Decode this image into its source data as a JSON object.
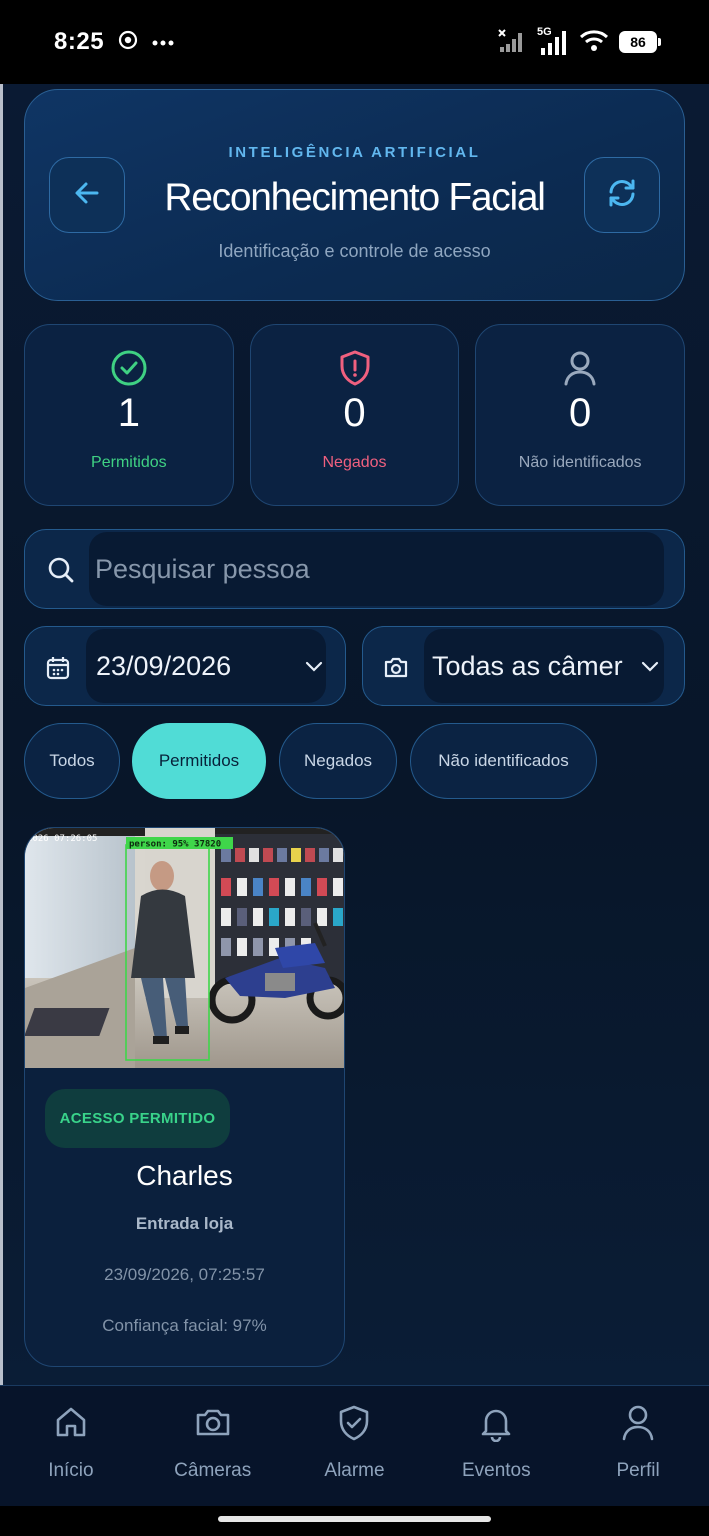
{
  "status_bar": {
    "time": "8:25",
    "network": "5G",
    "battery": "86"
  },
  "header": {
    "kicker": "INTELIGÊNCIA ARTIFICIAL",
    "title": "Reconhecimento Facial",
    "subtitle": "Identificação e controle de acesso",
    "back_icon": "arrow-left-icon",
    "refresh_icon": "refresh-icon"
  },
  "stats": [
    {
      "value": "1",
      "label": "Permitidos",
      "icon": "check-circle-icon",
      "color": "#3fd183"
    },
    {
      "value": "0",
      "label": "Negados",
      "icon": "shield-alert-icon",
      "color": "#f0607f"
    },
    {
      "value": "0",
      "label": "Não identificados",
      "icon": "user-icon",
      "color": "#9aa9bd"
    }
  ],
  "search": {
    "placeholder": "Pesquisar pessoa"
  },
  "filters": {
    "date": "23/09/2026",
    "camera": "Todas as câmer"
  },
  "chips": [
    {
      "label": "Todos",
      "active": false
    },
    {
      "label": "Permitidos",
      "active": true
    },
    {
      "label": "Negados",
      "active": false
    },
    {
      "label": "Não identificados",
      "active": false
    }
  ],
  "events": [
    {
      "badge": "ACESSO PERMITIDO",
      "name": "Charles",
      "location": "Entrada loja",
      "datetime": "23/09/2026, 07:25:57",
      "confidence": "Confiança facial: 97%",
      "image": {
        "overlay_label": "person: 95%  37820",
        "timestamp": "2026 07:26:05"
      }
    }
  ],
  "tabbar": [
    {
      "label": "Início",
      "icon": "home-icon"
    },
    {
      "label": "Câmeras",
      "icon": "camera-icon"
    },
    {
      "label": "Alarme",
      "icon": "shield-check-icon"
    },
    {
      "label": "Eventos",
      "icon": "bell-icon"
    },
    {
      "label": "Perfil",
      "icon": "user-icon"
    }
  ],
  "colors": {
    "accent": "#50dcd6",
    "allowed": "#3fd183",
    "denied": "#f0607f",
    "panel": "#0b2242"
  }
}
